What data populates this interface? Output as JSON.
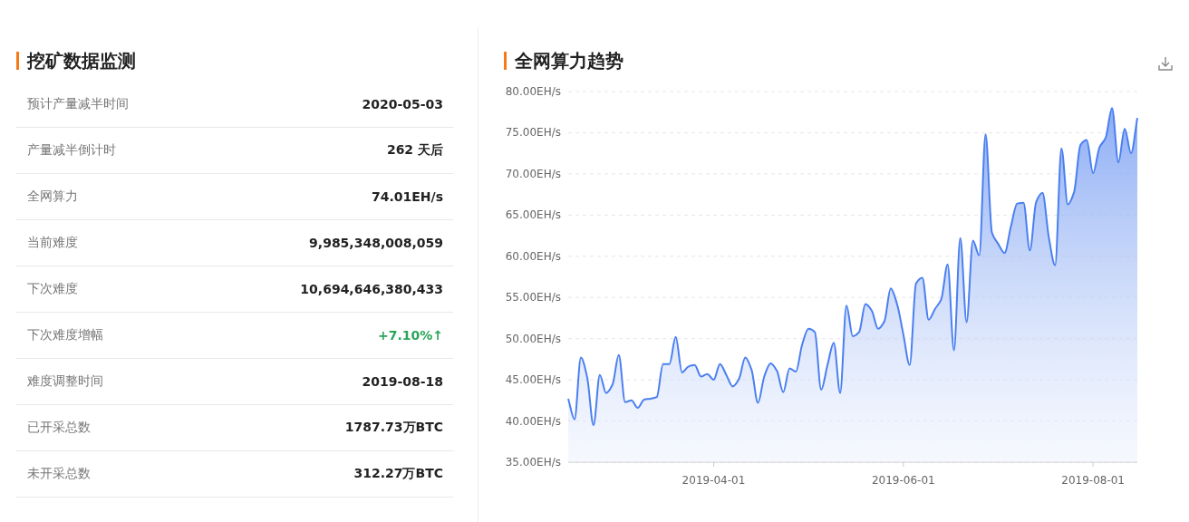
{
  "mining": {
    "title": "挖矿数据监测",
    "rows": [
      {
        "label": "预计产量减半时间",
        "value": "2020-05-03",
        "kind": "plain"
      },
      {
        "label": "产量减半倒计时",
        "value": "262 天后",
        "kind": "plain"
      },
      {
        "label": "全网算力",
        "value": "74.01EH/s",
        "kind": "plain"
      },
      {
        "label": "当前难度",
        "value": "9,985,348,008,059",
        "kind": "plain"
      },
      {
        "label": "下次难度",
        "value": "10,694,646,380,433",
        "kind": "plain"
      },
      {
        "label": "下次难度增幅",
        "value": "+7.10%↑",
        "kind": "rise"
      },
      {
        "label": "难度调整时间",
        "value": "2019-08-18",
        "kind": "plain"
      },
      {
        "label": "已开采总数",
        "value": "1787.73万BTC",
        "kind": "plain"
      },
      {
        "label": "未开采总数",
        "value": "312.27万BTC",
        "kind": "plain"
      }
    ]
  },
  "hashrate": {
    "title": "全网算力趋势",
    "chart_data": {
      "type": "area",
      "grid": true,
      "ylim": [
        35,
        80
      ],
      "yticks": [
        {
          "value": 35,
          "label": "35.00EH/s"
        },
        {
          "value": 40,
          "label": "40.00EH/s"
        },
        {
          "value": 45,
          "label": "45.00EH/s"
        },
        {
          "value": 50,
          "label": "50.00EH/s"
        },
        {
          "value": 55,
          "label": "55.00EH/s"
        },
        {
          "value": 60,
          "label": "60.00EH/s"
        },
        {
          "value": 65,
          "label": "65.00EH/s"
        },
        {
          "value": 70,
          "label": "70.00EH/s"
        },
        {
          "value": 75,
          "label": "75.00EH/s"
        },
        {
          "value": 80,
          "label": "80.00EH/s"
        }
      ],
      "categories": [
        null,
        null,
        null,
        null,
        null,
        null,
        null,
        null,
        null,
        null,
        null,
        null,
        null,
        null,
        null,
        null,
        null,
        null,
        null,
        null,
        null,
        null,
        null,
        "2019-04-01",
        null,
        null,
        null,
        null,
        null,
        null,
        null,
        null,
        null,
        null,
        null,
        null,
        null,
        null,
        null,
        null,
        null,
        null,
        null,
        null,
        null,
        null,
        null,
        null,
        null,
        null,
        null,
        null,
        null,
        "2019-06-01",
        null,
        null,
        null,
        null,
        null,
        null,
        null,
        null,
        null,
        null,
        null,
        null,
        null,
        null,
        null,
        null,
        null,
        null,
        null,
        null,
        null,
        null,
        null,
        null,
        null,
        null,
        null,
        null,
        null,
        "2019-08-01",
        null,
        null,
        null,
        null,
        null,
        null,
        null
      ],
      "series": [
        {
          "color": "#4a7ff0",
          "values": [
            42.7,
            40.2,
            47.7,
            45.3,
            39.5,
            45.6,
            43.4,
            44.4,
            48.0,
            42.3,
            42.5,
            41.6,
            42.6,
            42.7,
            42.9,
            46.9,
            46.9,
            50.2,
            45.9,
            46.6,
            46.8,
            45.4,
            45.7,
            45.0,
            46.9,
            45.6,
            44.2,
            45.1,
            47.7,
            46.2,
            42.2,
            45.4,
            47.0,
            46.1,
            43.5,
            46.4,
            46.0,
            49.3,
            51.2,
            50.8,
            43.8,
            46.8,
            49.5,
            43.4,
            54.0,
            50.3,
            50.8,
            54.2,
            53.4,
            51.2,
            52.1,
            56.1,
            54.2,
            50.5,
            46.8,
            56.7,
            57.4,
            52.3,
            53.6,
            54.8,
            59.0,
            48.6,
            62.2,
            52.0,
            61.9,
            60.1,
            74.8,
            62.9,
            61.5,
            60.4,
            63.6,
            66.4,
            66.5,
            60.7,
            66.6,
            67.7,
            62.3,
            58.9,
            73.1,
            66.3,
            67.8,
            73.5,
            74.1,
            70.1,
            73.2,
            74.4,
            78.0,
            71.4,
            75.5,
            72.5,
            76.8
          ]
        }
      ]
    }
  }
}
